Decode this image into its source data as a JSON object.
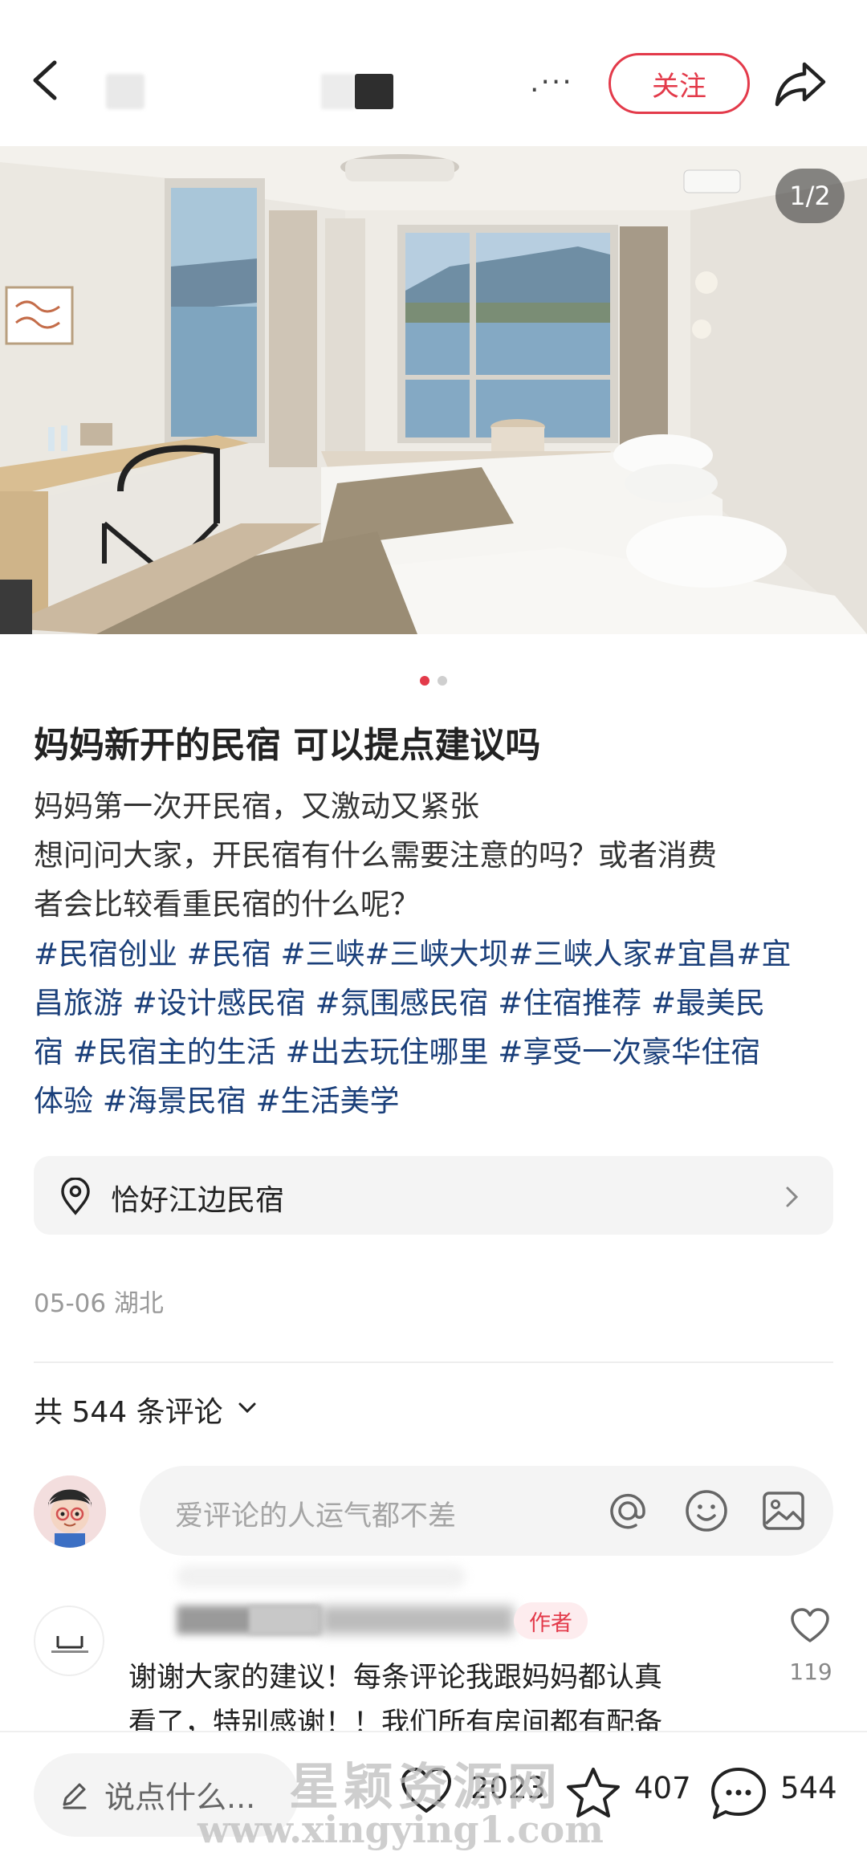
{
  "header": {
    "more_label": ".···",
    "follow_label": "关注"
  },
  "post": {
    "image_counter": "1/2",
    "title": "妈妈新开的民宿 可以提点建议吗",
    "body_lines": [
      "妈妈第一次开民宿，又激动又紧张",
      "想问问大家，开民宿有什么需要注意的吗？或者消费",
      "者会比较看重民宿的什么呢？"
    ],
    "tags_lines": [
      "#民宿创业 #民宿 #三峡#三峡大坝#三峡人家#宜昌#宜",
      "昌旅游 #设计感民宿 #氛围感民宿 #住宿推荐 #最美民",
      "宿 #民宿主的生活 #出去玩住哪里 #享受一次豪华住宿",
      "体验 #海景民宿 #生活美学"
    ],
    "location": "恰好江边民宿",
    "meta": "05-06 湖北"
  },
  "comments": {
    "count_label": "共 544 条评论",
    "input_placeholder": "爱评论的人运气都不差",
    "first": {
      "badge": "作者",
      "text_lines": [
        "谢谢大家的建议！每条评论我跟妈妈都认真",
        "看了，特别感谢！！我们所有房间都有配备"
      ],
      "likes": "119"
    }
  },
  "bottom_bar": {
    "say_placeholder": "说点什么...",
    "like_count": "2023",
    "star_count": "407",
    "comment_count": "544"
  },
  "watermark": {
    "line1": "星颖资源网",
    "line2": "www.xingying1.com"
  },
  "colors": {
    "accent": "#e33a4a",
    "tag": "#1a3f7a"
  }
}
